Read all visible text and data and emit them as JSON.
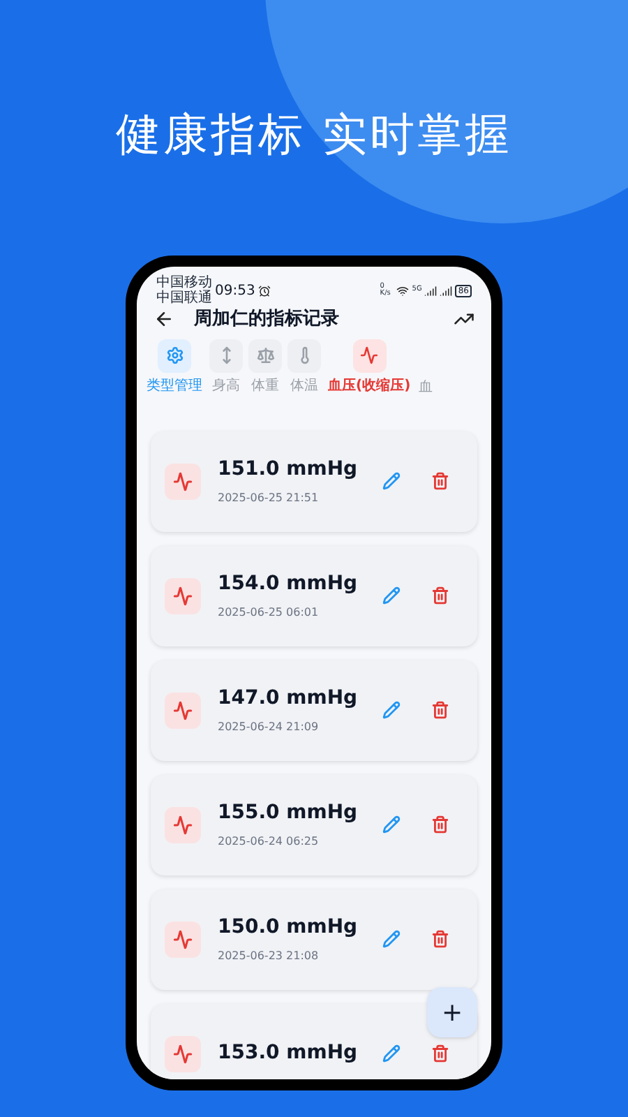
{
  "headline": "健康指标 实时掌握",
  "status_bar": {
    "carriers": [
      "中国移动",
      "中国联通"
    ],
    "time": "09:53",
    "net_speed": "0 K/s",
    "network": "5G",
    "battery": "86"
  },
  "header": {
    "title": "周加仁的指标记录"
  },
  "tabs": [
    {
      "kind": "settings",
      "label": "类型管理",
      "selected": false
    },
    {
      "kind": "height",
      "label": "身高",
      "selected": false
    },
    {
      "kind": "weight",
      "label": "体重",
      "selected": false
    },
    {
      "kind": "temperature",
      "label": "体温",
      "selected": false
    },
    {
      "kind": "pressure",
      "label": "血压(收缩压)",
      "selected": true
    },
    {
      "kind": "partial",
      "label": "血",
      "selected": false
    }
  ],
  "records": [
    {
      "value": "151.0 mmHg",
      "time": "2025-06-25 21:51"
    },
    {
      "value": "154.0 mmHg",
      "time": "2025-06-25 06:01"
    },
    {
      "value": "147.0 mmHg",
      "time": "2025-06-24 21:09"
    },
    {
      "value": "155.0 mmHg",
      "time": "2025-06-24 06:25"
    },
    {
      "value": "150.0 mmHg",
      "time": "2025-06-23 21:08"
    },
    {
      "value": "153.0 mmHg"
    }
  ],
  "fab": {
    "label": "+"
  }
}
